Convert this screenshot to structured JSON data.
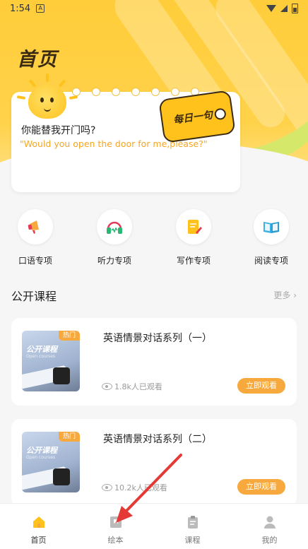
{
  "status_bar": {
    "time": "1:54",
    "notification_letter": "A"
  },
  "header": {
    "title": "首页"
  },
  "daily_sentence": {
    "tag": "每日一句",
    "chinese": "你能替我开门吗?",
    "english": "\"Would you open the door for me,please?\""
  },
  "categories": [
    {
      "label": "口语专项",
      "icon": "megaphone-icon"
    },
    {
      "label": "听力专项",
      "icon": "headphones-icon"
    },
    {
      "label": "写作专项",
      "icon": "notepad-pen-icon"
    },
    {
      "label": "阅读专项",
      "icon": "open-book-icon"
    }
  ],
  "public_courses": {
    "title": "公开课程",
    "more": "更多",
    "items": [
      {
        "title": "英语情景对话系列（一）",
        "views": "1.8k人已观看",
        "badge": "热门",
        "thumb_title": "公开课程",
        "thumb_sub": "Open courses",
        "button": "立即观看"
      },
      {
        "title": "英语情景对话系列（二）",
        "views": "10.2k人已观看",
        "badge": "热门",
        "thumb_title": "公开课程",
        "thumb_sub": "Open courses",
        "button": "立即观看"
      }
    ]
  },
  "tab_bar": {
    "items": [
      {
        "label": "首页",
        "icon": "home-icon",
        "active": true
      },
      {
        "label": "绘本",
        "icon": "picture-book-icon",
        "active": false
      },
      {
        "label": "课程",
        "icon": "clipboard-icon",
        "active": false
      },
      {
        "label": "我的",
        "icon": "person-icon",
        "active": false
      }
    ]
  },
  "colors": {
    "accent": "#ffc21d",
    "button": "#f8a93e",
    "english_text": "#f5a623",
    "annotation_arrow": "#e53935"
  }
}
